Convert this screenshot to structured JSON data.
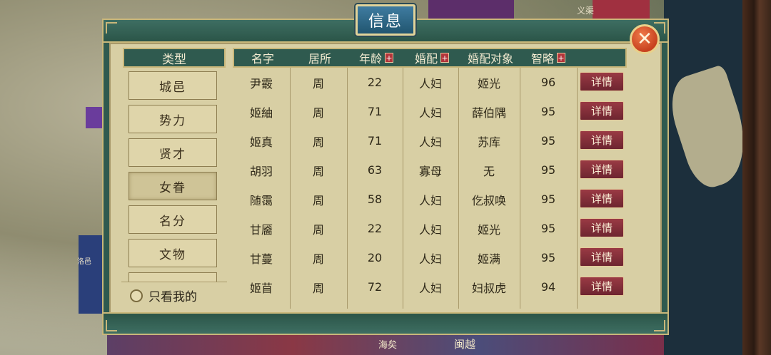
{
  "window": {
    "title": "信息",
    "close_icon": "close-icon"
  },
  "map_labels": {
    "top_right": "义渠",
    "left": "洛邑",
    "bottom_center": "海矣",
    "bottom_right": "闽越"
  },
  "sidebar": {
    "header": "类型",
    "items": [
      {
        "label": "城邑",
        "active": false
      },
      {
        "label": "势力",
        "active": false
      },
      {
        "label": "贤才",
        "active": false
      },
      {
        "label": "女眷",
        "active": true
      },
      {
        "label": "名分",
        "active": false
      },
      {
        "label": "文物",
        "active": false
      }
    ],
    "only_mine_label": "只看我的"
  },
  "table": {
    "headers": {
      "name": "名字",
      "residence": "居所",
      "age": "年龄",
      "marriage": "婚配",
      "spouse": "婚配对象",
      "strategy": "智略"
    },
    "detail_label": "详情",
    "rows": [
      {
        "name": "尹霰",
        "residence": "周",
        "age": "22",
        "marriage": "人妇",
        "spouse": "姬光",
        "strategy": "96"
      },
      {
        "name": "姬紬",
        "residence": "周",
        "age": "71",
        "marriage": "人妇",
        "spouse": "薛伯隅",
        "strategy": "95"
      },
      {
        "name": "姬真",
        "residence": "周",
        "age": "71",
        "marriage": "人妇",
        "spouse": "苏库",
        "strategy": "95"
      },
      {
        "name": "胡羽",
        "residence": "周",
        "age": "63",
        "marriage": "寡母",
        "spouse": "无",
        "strategy": "95"
      },
      {
        "name": "随霭",
        "residence": "周",
        "age": "58",
        "marriage": "人妇",
        "spouse": "仡叔唤",
        "strategy": "95"
      },
      {
        "name": "甘靥",
        "residence": "周",
        "age": "22",
        "marriage": "人妇",
        "spouse": "姬光",
        "strategy": "95"
      },
      {
        "name": "甘蔓",
        "residence": "周",
        "age": "20",
        "marriage": "人妇",
        "spouse": "姬满",
        "strategy": "95"
      },
      {
        "name": "姬苜",
        "residence": "周",
        "age": "72",
        "marriage": "人妇",
        "spouse": "妇叔虎",
        "strategy": "94"
      }
    ]
  }
}
